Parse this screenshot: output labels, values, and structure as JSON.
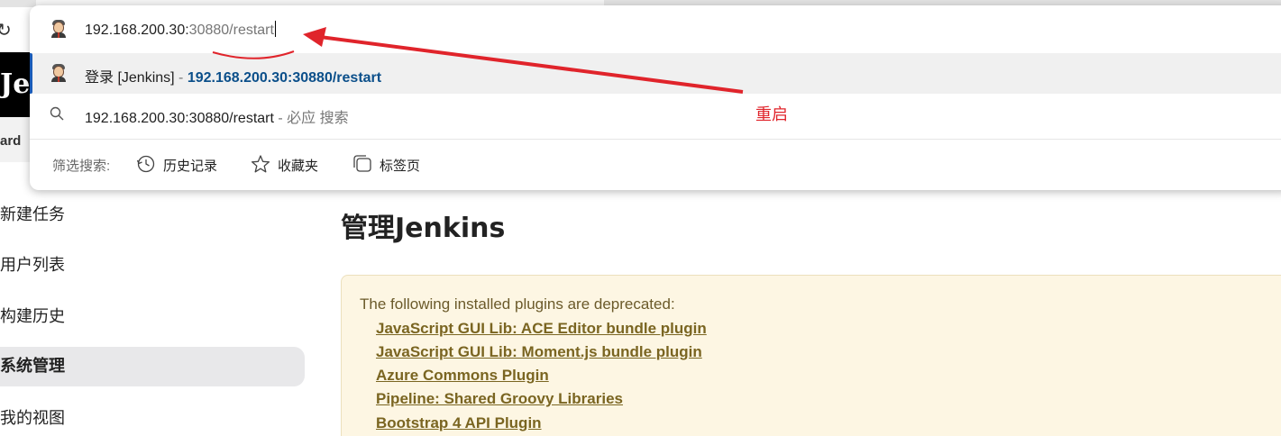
{
  "page": {
    "breadcrumb": "ard",
    "sidebar": [
      {
        "label": "新建任务"
      },
      {
        "label": "用户列表"
      },
      {
        "label": "构建历史"
      },
      {
        "label": "系统管理"
      },
      {
        "label": "我的视图"
      }
    ],
    "title": "管理Jenkins",
    "notice": {
      "intro": "The following installed plugins are deprecated:",
      "plugins": [
        "JavaScript GUI Lib: ACE Editor bundle plugin",
        "JavaScript GUI Lib: Moment.js bundle plugin",
        "Azure Commons Plugin",
        "Pipeline: Shared Groovy Libraries",
        "Bootstrap 4 API Plugin"
      ]
    }
  },
  "jenkins_logo_text": "Jen",
  "omnibox": {
    "input_host": "192.168.200.30:",
    "input_rest": "30880/restart",
    "suggestions": {
      "history": {
        "title": "登录 [Jenkins]",
        "separator": " - ",
        "url": "192.168.200.30:30880/restart"
      },
      "search": {
        "query": "192.168.200.30:30880/restart",
        "separator": " - ",
        "engine": "必应 搜索"
      }
    },
    "filter": {
      "label": "筛选搜索:",
      "chips": [
        {
          "label": "历史记录",
          "icon": "history-icon"
        },
        {
          "label": "收藏夹",
          "icon": "star-icon"
        },
        {
          "label": "标签页",
          "icon": "tabs-icon"
        }
      ]
    }
  },
  "annotation": {
    "label": "重启",
    "color": "#e0242b"
  },
  "colors": {
    "selected_accent": "#1a5cb8",
    "url_link": "#0b4f8a",
    "notice_bg": "#fdf6e3",
    "plugin_link": "#7a6521"
  }
}
